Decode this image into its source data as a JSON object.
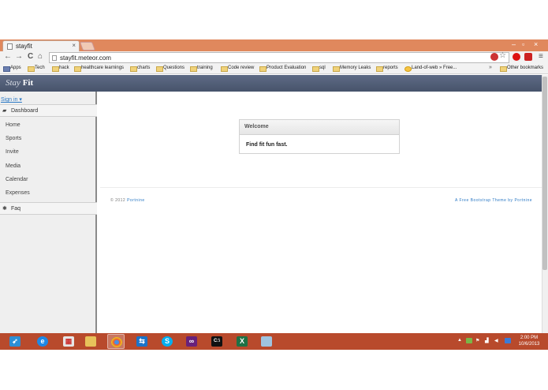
{
  "browser": {
    "tab_title": "stayfit",
    "tab_close": "×",
    "url": "stayfit.meteor.com",
    "window_controls": {
      "minimize": "–",
      "maximize": "▫",
      "close": "×"
    },
    "nav": {
      "back": "←",
      "forward": "→",
      "reload": "C",
      "home": "⌂"
    },
    "star": "☆",
    "menu": "≡",
    "bookmarks": [
      "Apps",
      "Tech",
      "hack",
      "healthcare learnings",
      "charts",
      "Questions",
      "training",
      "Code review",
      "Product Evaluation",
      "sql",
      "Memory Leaks",
      "reports",
      "Land-of-web » Free..."
    ],
    "more_bookmarks": "»",
    "other_bookmarks": "Other bookmarks"
  },
  "site": {
    "brand_italic": "Stay",
    "brand_bold": "Fit",
    "sign_in": "Sign in ▾",
    "sidebar": {
      "dashboard": "Dashboard",
      "items": [
        "Home",
        "Sports",
        "Invite",
        "Media",
        "Calendar",
        "Expenses"
      ],
      "faq": "Faq"
    },
    "panel": {
      "title": "Welcome",
      "body": "Find fit fun fast."
    },
    "footer": {
      "copyright": "© 2012",
      "copyright_link": "Portnine",
      "credit": "A Free Bootstrap Theme by",
      "credit_link": "Portnine"
    }
  },
  "taskbar": {
    "clock_time": "2:00 PM",
    "clock_date": "10/6/2013",
    "tray_arrow": "▲"
  },
  "colors": {
    "titlebar": "#e0885d",
    "navbar": "#4f5b73",
    "taskbar": "#b84a2c",
    "link": "#2a78c4"
  }
}
